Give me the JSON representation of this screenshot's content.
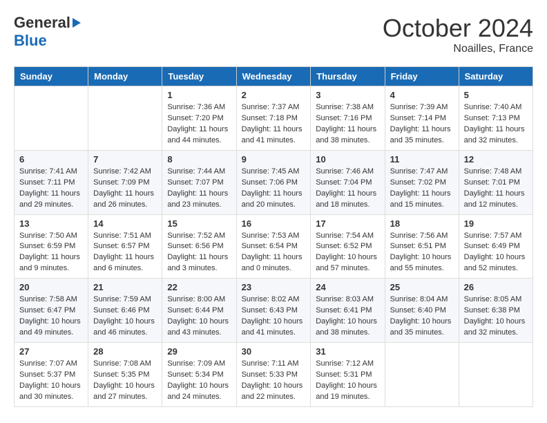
{
  "header": {
    "logo_general": "General",
    "logo_blue": "Blue",
    "month": "October 2024",
    "location": "Noailles, France"
  },
  "weekdays": [
    "Sunday",
    "Monday",
    "Tuesday",
    "Wednesday",
    "Thursday",
    "Friday",
    "Saturday"
  ],
  "weeks": [
    [
      {
        "day": "",
        "sunrise": "",
        "sunset": "",
        "daylight": ""
      },
      {
        "day": "",
        "sunrise": "",
        "sunset": "",
        "daylight": ""
      },
      {
        "day": "1",
        "sunrise": "Sunrise: 7:36 AM",
        "sunset": "Sunset: 7:20 PM",
        "daylight": "Daylight: 11 hours and 44 minutes."
      },
      {
        "day": "2",
        "sunrise": "Sunrise: 7:37 AM",
        "sunset": "Sunset: 7:18 PM",
        "daylight": "Daylight: 11 hours and 41 minutes."
      },
      {
        "day": "3",
        "sunrise": "Sunrise: 7:38 AM",
        "sunset": "Sunset: 7:16 PM",
        "daylight": "Daylight: 11 hours and 38 minutes."
      },
      {
        "day": "4",
        "sunrise": "Sunrise: 7:39 AM",
        "sunset": "Sunset: 7:14 PM",
        "daylight": "Daylight: 11 hours and 35 minutes."
      },
      {
        "day": "5",
        "sunrise": "Sunrise: 7:40 AM",
        "sunset": "Sunset: 7:13 PM",
        "daylight": "Daylight: 11 hours and 32 minutes."
      }
    ],
    [
      {
        "day": "6",
        "sunrise": "Sunrise: 7:41 AM",
        "sunset": "Sunset: 7:11 PM",
        "daylight": "Daylight: 11 hours and 29 minutes."
      },
      {
        "day": "7",
        "sunrise": "Sunrise: 7:42 AM",
        "sunset": "Sunset: 7:09 PM",
        "daylight": "Daylight: 11 hours and 26 minutes."
      },
      {
        "day": "8",
        "sunrise": "Sunrise: 7:44 AM",
        "sunset": "Sunset: 7:07 PM",
        "daylight": "Daylight: 11 hours and 23 minutes."
      },
      {
        "day": "9",
        "sunrise": "Sunrise: 7:45 AM",
        "sunset": "Sunset: 7:06 PM",
        "daylight": "Daylight: 11 hours and 20 minutes."
      },
      {
        "day": "10",
        "sunrise": "Sunrise: 7:46 AM",
        "sunset": "Sunset: 7:04 PM",
        "daylight": "Daylight: 11 hours and 18 minutes."
      },
      {
        "day": "11",
        "sunrise": "Sunrise: 7:47 AM",
        "sunset": "Sunset: 7:02 PM",
        "daylight": "Daylight: 11 hours and 15 minutes."
      },
      {
        "day": "12",
        "sunrise": "Sunrise: 7:48 AM",
        "sunset": "Sunset: 7:01 PM",
        "daylight": "Daylight: 11 hours and 12 minutes."
      }
    ],
    [
      {
        "day": "13",
        "sunrise": "Sunrise: 7:50 AM",
        "sunset": "Sunset: 6:59 PM",
        "daylight": "Daylight: 11 hours and 9 minutes."
      },
      {
        "day": "14",
        "sunrise": "Sunrise: 7:51 AM",
        "sunset": "Sunset: 6:57 PM",
        "daylight": "Daylight: 11 hours and 6 minutes."
      },
      {
        "day": "15",
        "sunrise": "Sunrise: 7:52 AM",
        "sunset": "Sunset: 6:56 PM",
        "daylight": "Daylight: 11 hours and 3 minutes."
      },
      {
        "day": "16",
        "sunrise": "Sunrise: 7:53 AM",
        "sunset": "Sunset: 6:54 PM",
        "daylight": "Daylight: 11 hours and 0 minutes."
      },
      {
        "day": "17",
        "sunrise": "Sunrise: 7:54 AM",
        "sunset": "Sunset: 6:52 PM",
        "daylight": "Daylight: 10 hours and 57 minutes."
      },
      {
        "day": "18",
        "sunrise": "Sunrise: 7:56 AM",
        "sunset": "Sunset: 6:51 PM",
        "daylight": "Daylight: 10 hours and 55 minutes."
      },
      {
        "day": "19",
        "sunrise": "Sunrise: 7:57 AM",
        "sunset": "Sunset: 6:49 PM",
        "daylight": "Daylight: 10 hours and 52 minutes."
      }
    ],
    [
      {
        "day": "20",
        "sunrise": "Sunrise: 7:58 AM",
        "sunset": "Sunset: 6:47 PM",
        "daylight": "Daylight: 10 hours and 49 minutes."
      },
      {
        "day": "21",
        "sunrise": "Sunrise: 7:59 AM",
        "sunset": "Sunset: 6:46 PM",
        "daylight": "Daylight: 10 hours and 46 minutes."
      },
      {
        "day": "22",
        "sunrise": "Sunrise: 8:00 AM",
        "sunset": "Sunset: 6:44 PM",
        "daylight": "Daylight: 10 hours and 43 minutes."
      },
      {
        "day": "23",
        "sunrise": "Sunrise: 8:02 AM",
        "sunset": "Sunset: 6:43 PM",
        "daylight": "Daylight: 10 hours and 41 minutes."
      },
      {
        "day": "24",
        "sunrise": "Sunrise: 8:03 AM",
        "sunset": "Sunset: 6:41 PM",
        "daylight": "Daylight: 10 hours and 38 minutes."
      },
      {
        "day": "25",
        "sunrise": "Sunrise: 8:04 AM",
        "sunset": "Sunset: 6:40 PM",
        "daylight": "Daylight: 10 hours and 35 minutes."
      },
      {
        "day": "26",
        "sunrise": "Sunrise: 8:05 AM",
        "sunset": "Sunset: 6:38 PM",
        "daylight": "Daylight: 10 hours and 32 minutes."
      }
    ],
    [
      {
        "day": "27",
        "sunrise": "Sunrise: 7:07 AM",
        "sunset": "Sunset: 5:37 PM",
        "daylight": "Daylight: 10 hours and 30 minutes."
      },
      {
        "day": "28",
        "sunrise": "Sunrise: 7:08 AM",
        "sunset": "Sunset: 5:35 PM",
        "daylight": "Daylight: 10 hours and 27 minutes."
      },
      {
        "day": "29",
        "sunrise": "Sunrise: 7:09 AM",
        "sunset": "Sunset: 5:34 PM",
        "daylight": "Daylight: 10 hours and 24 minutes."
      },
      {
        "day": "30",
        "sunrise": "Sunrise: 7:11 AM",
        "sunset": "Sunset: 5:33 PM",
        "daylight": "Daylight: 10 hours and 22 minutes."
      },
      {
        "day": "31",
        "sunrise": "Sunrise: 7:12 AM",
        "sunset": "Sunset: 5:31 PM",
        "daylight": "Daylight: 10 hours and 19 minutes."
      },
      {
        "day": "",
        "sunrise": "",
        "sunset": "",
        "daylight": ""
      },
      {
        "day": "",
        "sunrise": "",
        "sunset": "",
        "daylight": ""
      }
    ]
  ]
}
